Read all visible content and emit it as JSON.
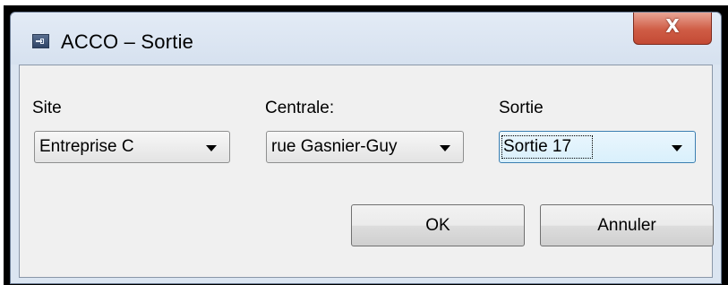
{
  "window": {
    "title": "ACCO – Sortie",
    "close_label": "X"
  },
  "fields": {
    "site": {
      "label": "Site",
      "value": "Entreprise C"
    },
    "centrale": {
      "label": "Centrale:",
      "value": "rue Gasnier-Guy"
    },
    "sortie": {
      "label": "Sortie",
      "value": "Sortie 17"
    }
  },
  "buttons": {
    "ok": "OK",
    "cancel": "Annuler"
  },
  "icons": {
    "app": "app-window-icon",
    "dropdown": "chevron-down-icon",
    "close": "close-icon"
  },
  "colors": {
    "close_button": "#c95a45",
    "focus_border": "#3c7fb1"
  }
}
